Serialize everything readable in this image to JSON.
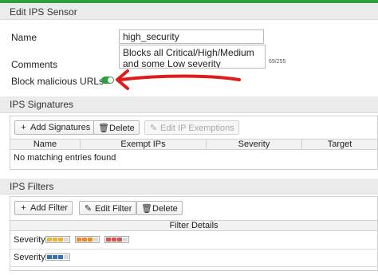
{
  "header": {
    "title": "Edit IPS Sensor"
  },
  "form": {
    "name_label": "Name",
    "name_value": "high_security",
    "comments_label": "Comments",
    "comments_value": "Blocks all Critical/High/Medium and some Low severity vulnerabilities",
    "comments_counter": "69/255",
    "block_urls_label": "Block malicious URLs",
    "block_urls_enabled": true
  },
  "signatures": {
    "title": "IPS Signatures",
    "buttons": {
      "add": "Add Signatures",
      "delete": "Delete",
      "edit_exemptions": "Edit IP Exemptions"
    },
    "columns": [
      "Name",
      "Exempt IPs",
      "Severity",
      "Target"
    ],
    "empty_text": "No matching entries found"
  },
  "filters": {
    "title": "IPS Filters",
    "buttons": {
      "add": "Add Filter",
      "edit": "Edit Filter",
      "delete": "Delete"
    },
    "column": "Filter Details",
    "rows": [
      {
        "label": "Severity:",
        "groups": [
          {
            "color": "#e8b53c",
            "cells": 4
          },
          {
            "color": "#e88a2e",
            "cells": 4
          },
          {
            "color": "#d9534f",
            "cells": 4
          }
        ]
      },
      {
        "label": "Severity:",
        "groups": [
          {
            "color": "#3a6fb0",
            "cells": 4
          }
        ]
      }
    ]
  },
  "annotation": {
    "arrow_color": "#e01b1b"
  }
}
